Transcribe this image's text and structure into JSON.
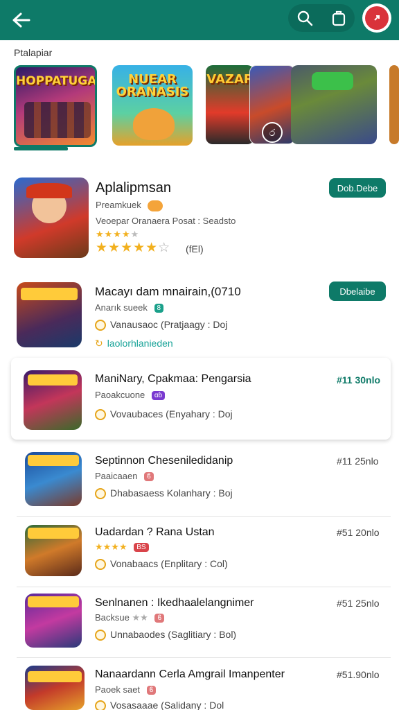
{
  "header": {
    "back_icon": "arrow-left-icon",
    "search_icon": "search-icon",
    "share_icon": "share-icon",
    "account_icon": "account-icon",
    "colors": {
      "bar": "#0e7a68",
      "accent": "#d9333b"
    }
  },
  "section_label": "Ptalapiar",
  "featured": [
    {
      "title": "HOPPATUGAN"
    },
    {
      "title": "NUEAR ORANASIS"
    },
    {
      "title": "VAZAR"
    },
    {
      "title": ""
    },
    {
      "title": ""
    }
  ],
  "overlay_icon_text": "ර",
  "main_app": {
    "title": "Aplalipmsan",
    "developer": "Preamkuek",
    "line": "Veoepar Oranaera Posat : Seadsto",
    "rating_text": "(fEl)",
    "button": "Dob.Debe"
  },
  "list": [
    {
      "title": "Macayı dam mnairain,(0710",
      "dev": "Anarık sueek",
      "line": "Vanausaoc  (Pratjaagy : Doj",
      "link": "laolorhlanieden",
      "button": "Dbelaibe"
    },
    {
      "title": "ManiNary, Cpakmaa: Pengarsia",
      "dev": "Paoakcuone",
      "line": "Vovaubaces  (Enyahary : Doj",
      "price": "#11 30nlo"
    },
    {
      "title": "Septinnon Cheseniledidanip",
      "dev": "Paaicaaen",
      "line": "Dhabasaess  Kolanhary : Boj",
      "price": "#11 25nlo"
    },
    {
      "title": "Uadardan ? Rana Ustan",
      "dev": "★★★★",
      "line": "Vonabaacs  (Enplitary : Col)",
      "price": "#51 20nlo"
    },
    {
      "title": "Senlnanen : Ikedhaalelangnimer",
      "dev": "Backsue",
      "line": "Unnabaodes  (Saglitiary : Bol)",
      "price": "#51 25nlo"
    },
    {
      "title": "Nanaardann Cerla Amgrail Imanpenter",
      "dev": "Paoek saet",
      "line": "Vosasaaae  (Salidany : Dol",
      "price": "#51.90nlo"
    }
  ]
}
